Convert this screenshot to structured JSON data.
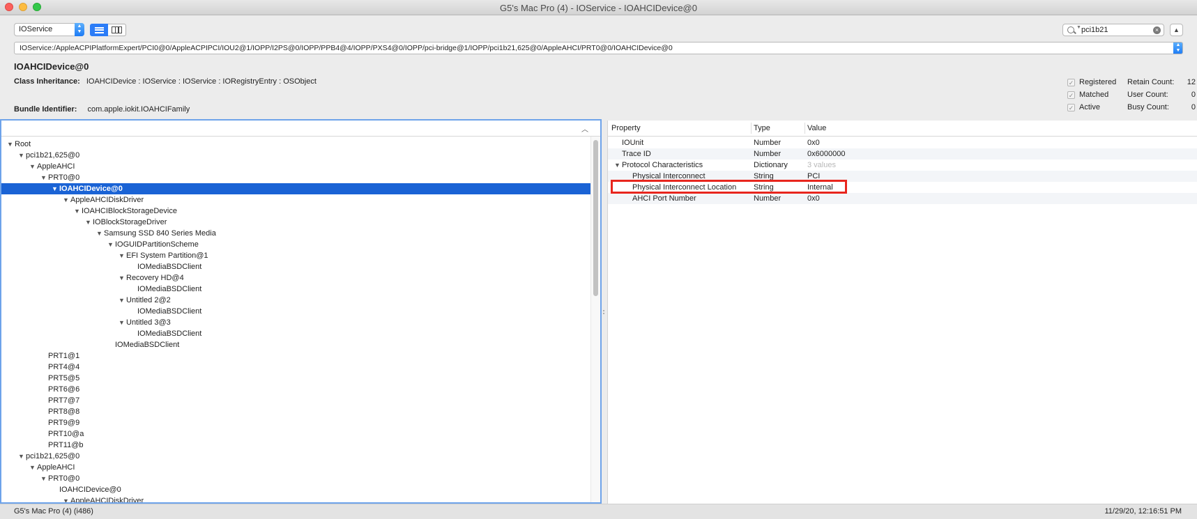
{
  "window": {
    "title": "G5's Mac Pro (4) - IOService - IOAHCIDevice@0"
  },
  "toolbar": {
    "plane": "IOService",
    "search_value": "pci1b21"
  },
  "path": "IOService:/AppleACPIPlatformExpert/PCI0@0/AppleACPIPCI/IOU2@1/IOPP/I2PS@0/IOPP/PPB4@4/IOPP/PXS4@0/IOPP/pci-bridge@1/IOPP/pci1b21,625@0/AppleAHCI/PRT0@0/IOAHCIDevice@0",
  "device": {
    "name": "IOAHCIDevice@0",
    "class_label": "Class Inheritance:",
    "class_value": "IOAHCIDevice : IOService : IOService : IORegistryEntry : OSObject",
    "bundle_label": "Bundle Identifier:",
    "bundle_value": "com.apple.iokit.IOAHCIFamily"
  },
  "status_checks": [
    {
      "label": "Registered",
      "checked": true
    },
    {
      "label": "Matched",
      "checked": true
    },
    {
      "label": "Active",
      "checked": true
    }
  ],
  "counts": [
    {
      "label": "Retain Count:",
      "value": "12"
    },
    {
      "label": "User Count:",
      "value": "0"
    },
    {
      "label": "Busy Count:",
      "value": "0"
    }
  ],
  "tree": [
    {
      "name": "Root",
      "depth": 0,
      "expanded": true
    },
    {
      "name": "pci1b21,625@0",
      "depth": 1,
      "expanded": true
    },
    {
      "name": "AppleAHCI",
      "depth": 2,
      "expanded": true
    },
    {
      "name": "PRT0@0",
      "depth": 3,
      "expanded": true
    },
    {
      "name": "IOAHCIDevice@0",
      "depth": 4,
      "expanded": true,
      "selected": true
    },
    {
      "name": "AppleAHCIDiskDriver",
      "depth": 5,
      "expanded": true
    },
    {
      "name": "IOAHCIBlockStorageDevice",
      "depth": 6,
      "expanded": true
    },
    {
      "name": "IOBlockStorageDriver",
      "depth": 7,
      "expanded": true
    },
    {
      "name": "Samsung SSD 840 Series Media",
      "depth": 8,
      "expanded": true
    },
    {
      "name": "IOGUIDPartitionScheme",
      "depth": 9,
      "expanded": true
    },
    {
      "name": "EFI System Partition@1",
      "depth": 10,
      "expanded": true
    },
    {
      "name": "IOMediaBSDClient",
      "depth": 11,
      "expanded": false
    },
    {
      "name": "Recovery HD@4",
      "depth": 10,
      "expanded": true
    },
    {
      "name": "IOMediaBSDClient",
      "depth": 11,
      "expanded": false
    },
    {
      "name": "Untitled 2@2",
      "depth": 10,
      "expanded": true
    },
    {
      "name": "IOMediaBSDClient",
      "depth": 11,
      "expanded": false
    },
    {
      "name": "Untitled 3@3",
      "depth": 10,
      "expanded": true
    },
    {
      "name": "IOMediaBSDClient",
      "depth": 11,
      "expanded": false
    },
    {
      "name": "IOMediaBSDClient",
      "depth": 9,
      "expanded": false
    },
    {
      "name": "PRT1@1",
      "depth": 3,
      "expanded": false
    },
    {
      "name": "PRT4@4",
      "depth": 3,
      "expanded": false
    },
    {
      "name": "PRT5@5",
      "depth": 3,
      "expanded": false
    },
    {
      "name": "PRT6@6",
      "depth": 3,
      "expanded": false
    },
    {
      "name": "PRT7@7",
      "depth": 3,
      "expanded": false
    },
    {
      "name": "PRT8@8",
      "depth": 3,
      "expanded": false
    },
    {
      "name": "PRT9@9",
      "depth": 3,
      "expanded": false
    },
    {
      "name": "PRT10@a",
      "depth": 3,
      "expanded": false
    },
    {
      "name": "PRT11@b",
      "depth": 3,
      "expanded": false
    },
    {
      "name": "pci1b21,625@0",
      "depth": 1,
      "expanded": true
    },
    {
      "name": "AppleAHCI",
      "depth": 2,
      "expanded": true
    },
    {
      "name": "PRT0@0",
      "depth": 3,
      "expanded": true
    },
    {
      "name": "IOAHCIDevice@0",
      "depth": 4,
      "expanded": false
    },
    {
      "name": "AppleAHCIDiskDriver",
      "depth": 5,
      "expanded": true
    }
  ],
  "properties": {
    "headers": {
      "property": "Property",
      "type": "Type",
      "value": "Value"
    },
    "rows": [
      {
        "key": "IOUnit",
        "type": "Number",
        "value": "0x0",
        "depth": 1
      },
      {
        "key": "Trace ID",
        "type": "Number",
        "value": "0x6000000",
        "depth": 1
      },
      {
        "key": "Protocol Characteristics",
        "type": "Dictionary",
        "value": "3 values",
        "depth": 1,
        "expanded": true,
        "muted": true
      },
      {
        "key": "Physical Interconnect",
        "type": "String",
        "value": "PCI",
        "depth": 2
      },
      {
        "key": "Physical Interconnect Location",
        "type": "String",
        "value": "Internal",
        "depth": 2,
        "highlighted": true
      },
      {
        "key": "AHCI Port Number",
        "type": "Number",
        "value": "0x0",
        "depth": 2
      }
    ]
  },
  "status": {
    "left": "G5's Mac Pro (4) (i486)",
    "right": "11/29/20, 12:16:51 PM"
  }
}
